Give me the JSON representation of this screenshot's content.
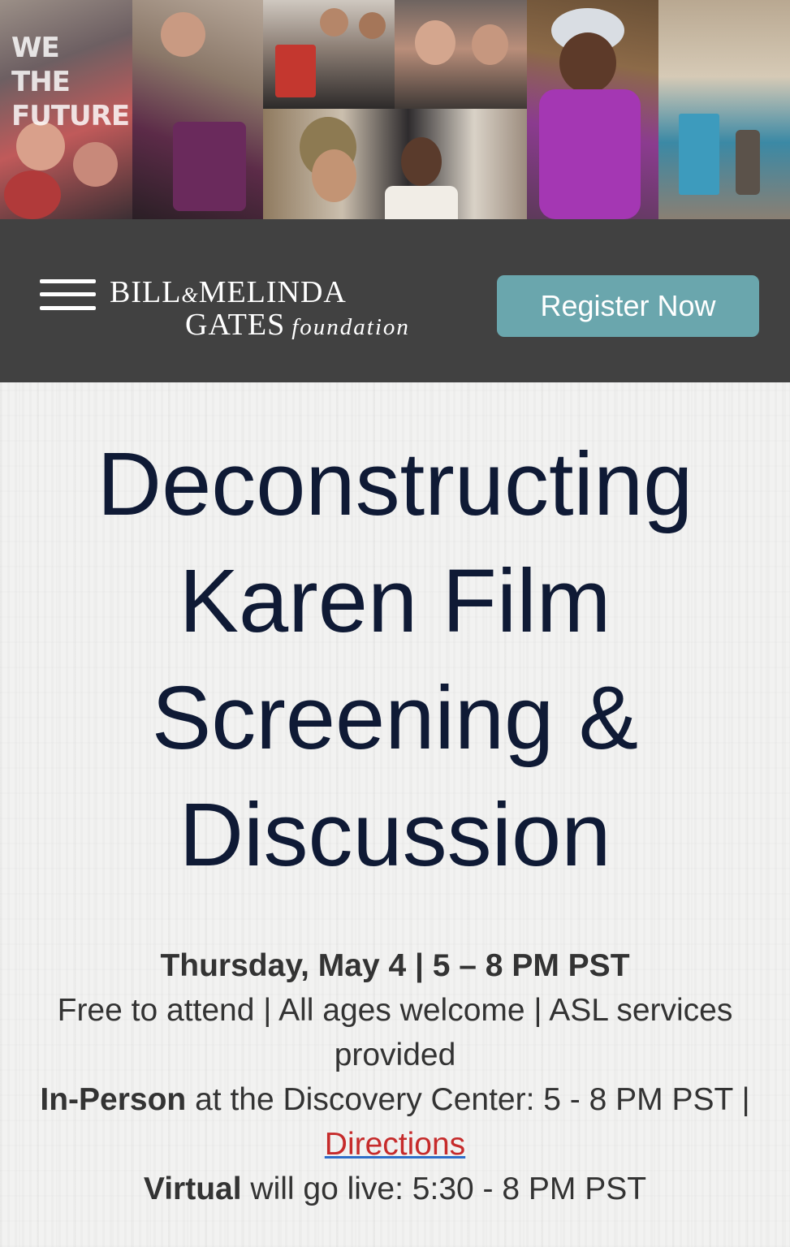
{
  "collage": {
    "overlay_text": "WE THE FUTURE",
    "photos": [
      "wall-mural-crowd-photo",
      "volunteer-tshirt-photo",
      "teens-holding-book-photo",
      "group-selfie-photo",
      "students-listening-photo",
      "speaker-microphone-photo",
      "museum-hallway-photo"
    ]
  },
  "header": {
    "menu_icon": "hamburger-icon",
    "logo": {
      "bill": "BILL",
      "amp": "&",
      "melinda": "MELINDA",
      "gates": "GATES",
      "foundation": "foundation"
    },
    "register_label": "Register Now",
    "colors": {
      "bar": "#414141",
      "button": "#6aa6ad"
    }
  },
  "event": {
    "title": "Deconstructing Karen Film Screening & Discussion",
    "date": "Thursday, May 4 | 5 – 8 PM PST",
    "access": "Free to attend | All ages welcome | ASL services provided",
    "in_person_label": "In-Person",
    "in_person_text": " at the Discovery Center: 5 - 8 PM PST | ",
    "directions_label": "Directions",
    "virtual_label": "Virtual",
    "virtual_text": " will go live: 5:30 - 8 PM PST",
    "colors": {
      "title": "#0f1a35",
      "link": "#c62b2b"
    }
  }
}
